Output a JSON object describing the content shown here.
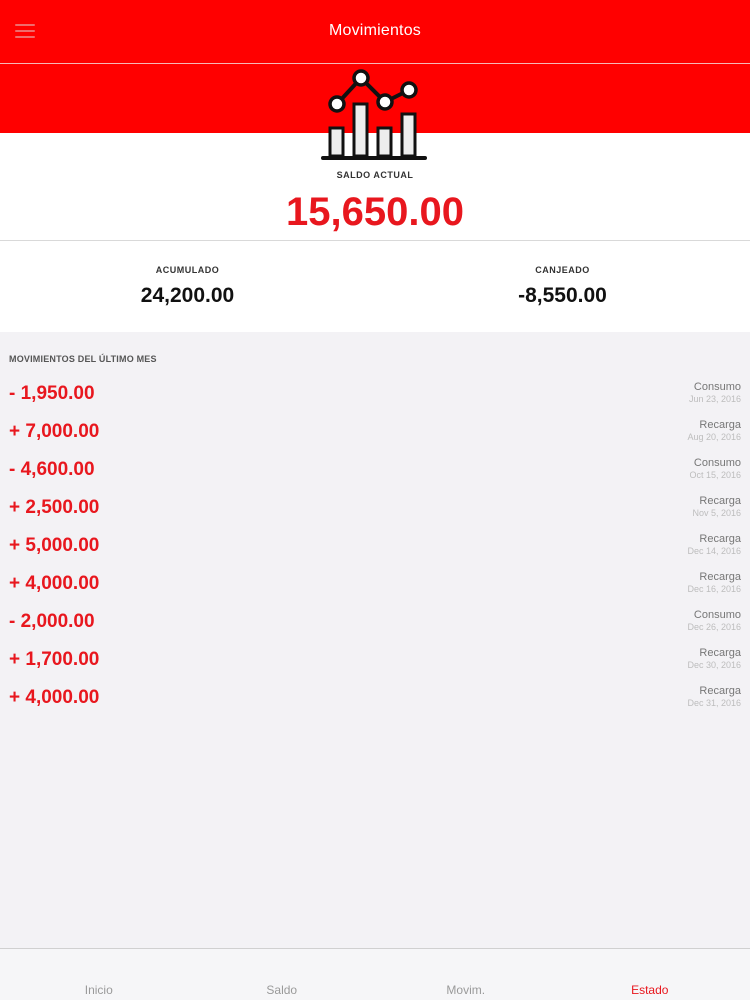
{
  "header": {
    "title": "Movimientos",
    "menu_icon": "hamburger-icon"
  },
  "summary": {
    "icon": "bar-line-chart-icon",
    "saldo_label": "SALDO ACTUAL",
    "saldo_value": "15,650.00",
    "acumulado_label": "ACUMULADO",
    "acumulado_value": "24,200.00",
    "canjeado_label": "CANJEADO",
    "canjeado_value": "-8,550.00"
  },
  "movements": {
    "title": "MOVIMIENTOS DEL ÚLTIMO MES",
    "items": [
      {
        "amount": "- 1,950.00",
        "type": "Consumo",
        "date": "Jun 23, 2016"
      },
      {
        "amount": "+ 7,000.00",
        "type": "Recarga",
        "date": "Aug 20, 2016"
      },
      {
        "amount": "- 4,600.00",
        "type": "Consumo",
        "date": "Oct 15, 2016"
      },
      {
        "amount": "+ 2,500.00",
        "type": "Recarga",
        "date": "Nov 5, 2016"
      },
      {
        "amount": "+ 5,000.00",
        "type": "Recarga",
        "date": "Dec 14, 2016"
      },
      {
        "amount": "+ 4,000.00",
        "type": "Recarga",
        "date": "Dec 16, 2016"
      },
      {
        "amount": "- 2,000.00",
        "type": "Consumo",
        "date": "Dec 26, 2016"
      },
      {
        "amount": "+ 1,700.00",
        "type": "Recarga",
        "date": "Dec 30, 2016"
      },
      {
        "amount": "+ 4,000.00",
        "type": "Recarga",
        "date": "Dec 31, 2016"
      }
    ]
  },
  "tabs": [
    {
      "label": "Inicio",
      "active": false
    },
    {
      "label": "Saldo",
      "active": false
    },
    {
      "label": "Movim.",
      "active": false
    },
    {
      "label": "Estado",
      "active": true
    }
  ],
  "colors": {
    "brand_red": "#ff0000",
    "amount_red": "#e8171e",
    "background": "#f3f2f5"
  }
}
